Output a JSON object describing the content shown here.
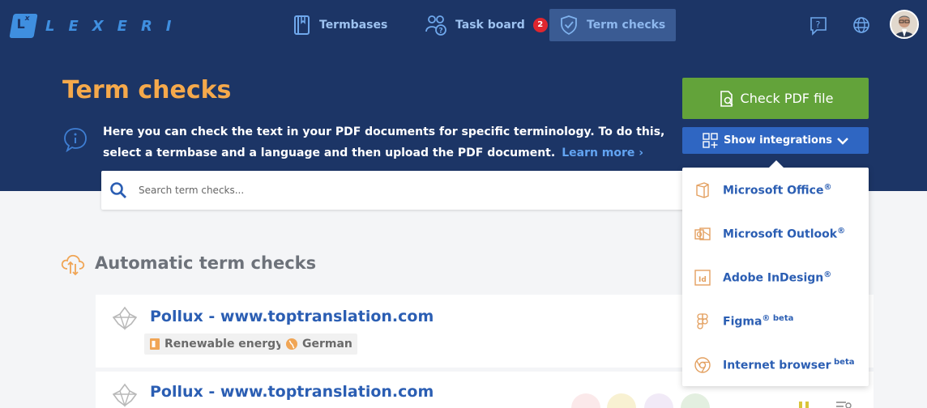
{
  "app": {
    "logo_mark": "L",
    "logo_sup": "x",
    "logo_text": "LEXERI"
  },
  "nav": {
    "termbases": "Termbases",
    "taskboard": "Task board",
    "taskboard_badge": "2",
    "termchecks": "Term checks"
  },
  "header": {
    "title": "Term checks",
    "description": "Here you can check the text in your PDF documents for specific terminology. To do this, select a termbase and a language and then upload the PDF document.",
    "learn_more": "Learn more ›"
  },
  "actions": {
    "check_pdf": "Check PDF file",
    "show_integrations": "Show integrations"
  },
  "search": {
    "placeholder": "Search term checks..."
  },
  "section": {
    "title": "Automatic term checks"
  },
  "checks": [
    {
      "title": "Pollux - www.toptranslation.com",
      "domain": "Renewable energy",
      "language": "German"
    },
    {
      "title": "Pollux - www.toptranslation.com"
    }
  ],
  "integrations": [
    {
      "name": "Microsoft Office",
      "mark": "®",
      "suffix": "",
      "icon": "office-icon"
    },
    {
      "name": "Microsoft Outlook",
      "mark": "®",
      "suffix": "",
      "icon": "outlook-icon"
    },
    {
      "name": "Adobe InDesign",
      "mark": "®",
      "suffix": "",
      "icon": "indesign-icon"
    },
    {
      "name": "Figma",
      "mark": "®",
      "suffix": " beta",
      "icon": "figma-icon"
    },
    {
      "name": "Internet browser",
      "mark": "",
      "suffix": " beta",
      "icon": "browser-icon"
    }
  ],
  "colors": {
    "navy": "#1c3566",
    "accent_orange": "#f5a94b",
    "primary_blue": "#2f66c2",
    "green": "#63a33a",
    "link": "#2b5eb3"
  }
}
